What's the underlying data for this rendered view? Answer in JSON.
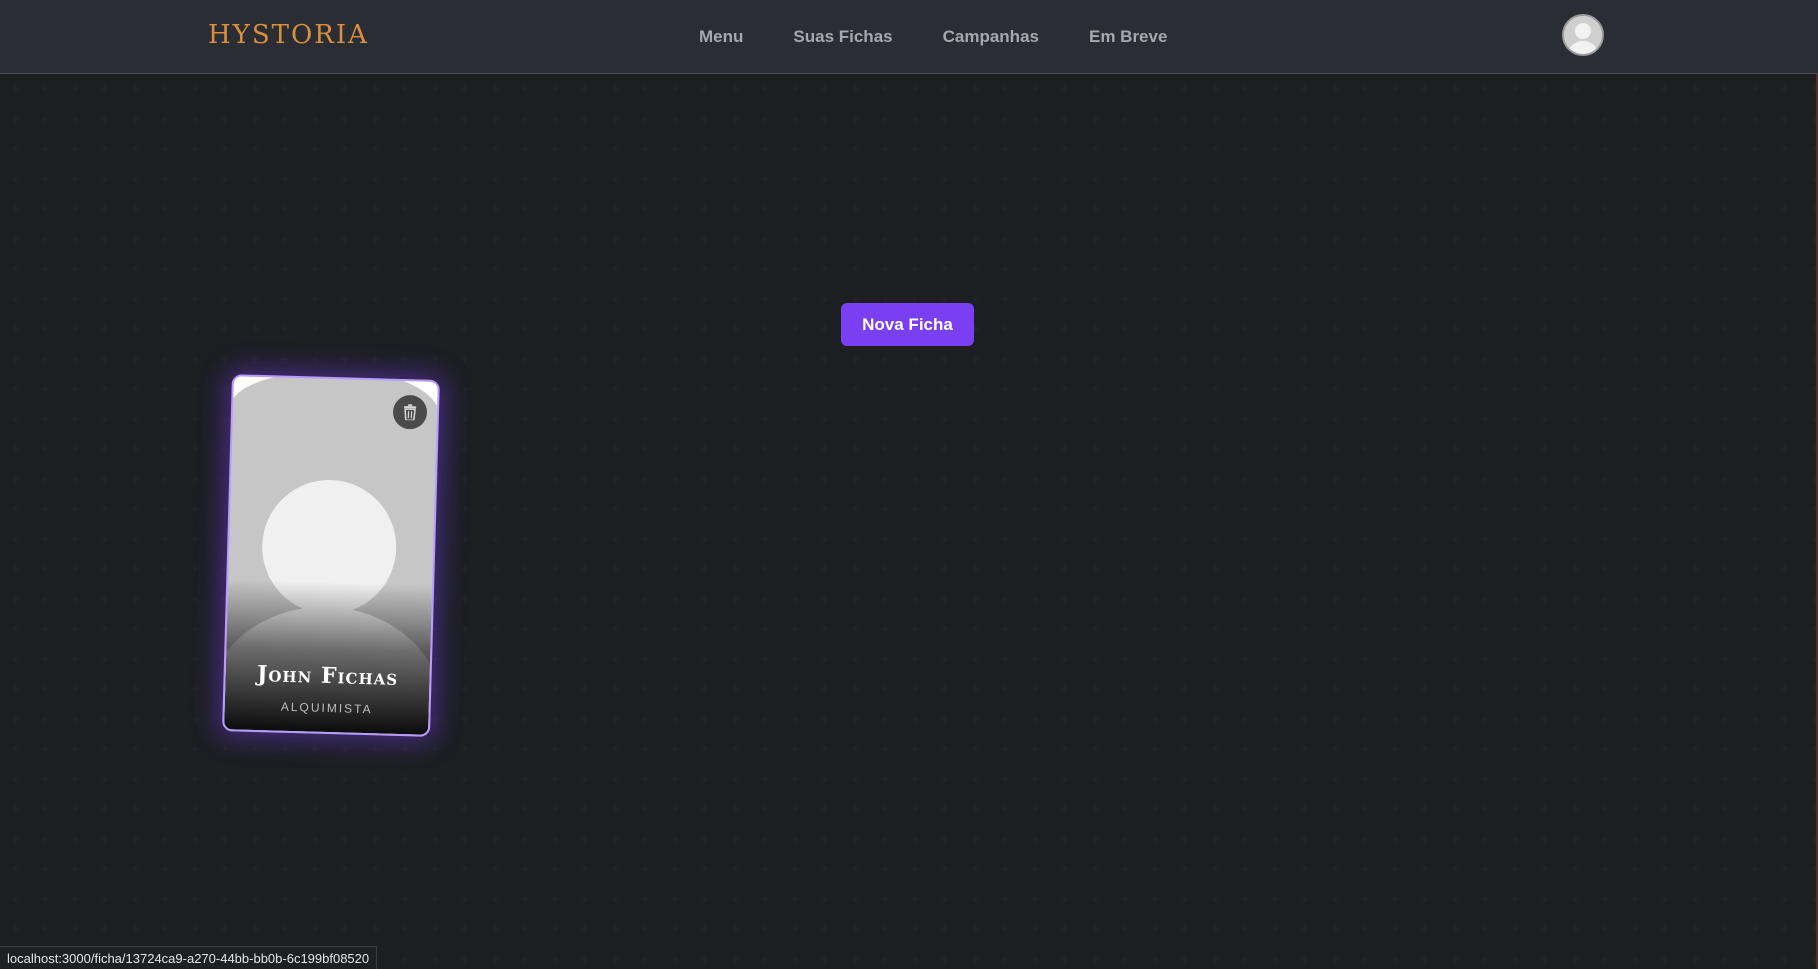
{
  "header": {
    "logo": "HYSTORIA",
    "nav": [
      {
        "label": "Menu"
      },
      {
        "label": "Suas Fichas"
      },
      {
        "label": "Campanhas"
      },
      {
        "label": "Em Breve"
      }
    ]
  },
  "main": {
    "new_button_label": "Nova Ficha",
    "cards": [
      {
        "name": "John Fichas",
        "class": "ALQUIMISTA"
      }
    ]
  },
  "status_bar": {
    "url": "localhost:3000/ficha/13724ca9-a270-44bb-bb0b-6c199bf08520"
  },
  "colors": {
    "accent": "#7b3ff2",
    "logo": "#d98f3c",
    "background": "#1c1e22",
    "navbar": "#2a2d33"
  },
  "icons": {
    "avatar": "user-avatar-icon",
    "delete": "trash-icon"
  }
}
